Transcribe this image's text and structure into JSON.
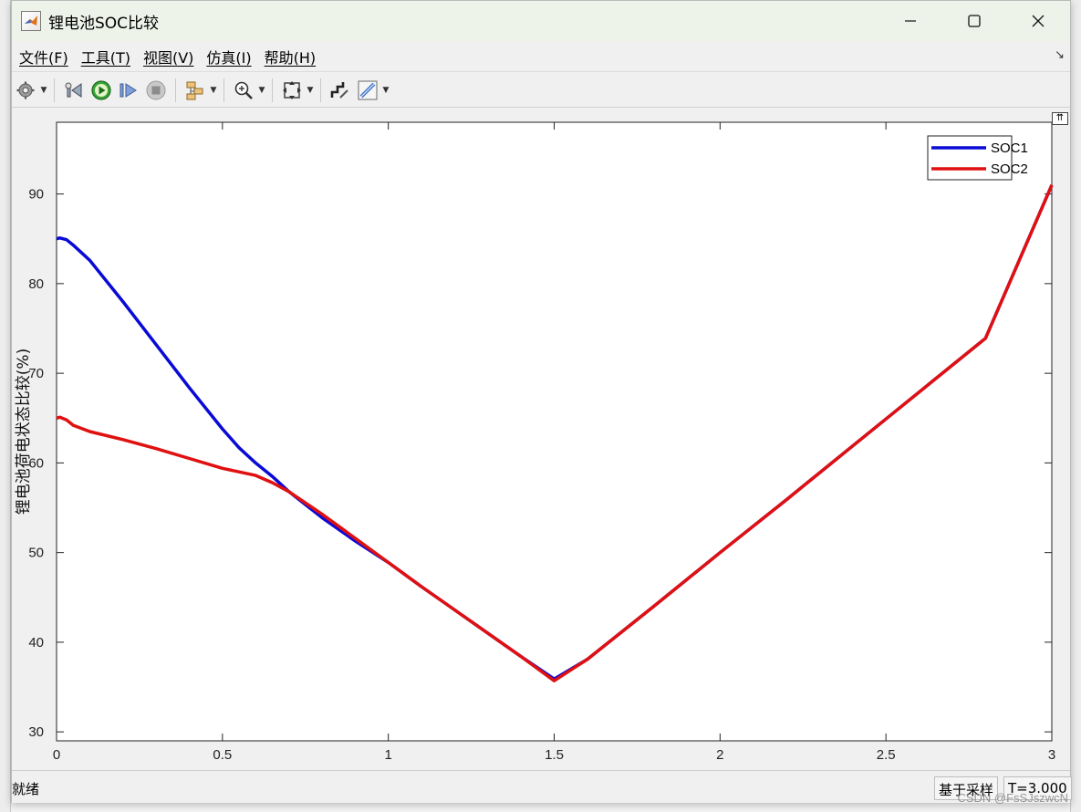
{
  "window": {
    "title": "锂电池SOC比较"
  },
  "menu": [
    {
      "label": "文件(F)"
    },
    {
      "label": "工具(T)"
    },
    {
      "label": "视图(V)"
    },
    {
      "label": "仿真(I)"
    },
    {
      "label": "帮助(H)"
    }
  ],
  "toolbar": {
    "icons": [
      "gear-icon",
      "step-back-icon",
      "run-icon",
      "step-forward-icon",
      "stop-icon",
      "signal-select-icon",
      "zoom-icon",
      "fit-view-icon",
      "style-icon",
      "measure-icon"
    ]
  },
  "status": {
    "text": "就绪",
    "solver": "基于采样",
    "time": "T=3.000"
  },
  "watermark": "CSDN @FsSJszwcN",
  "chart_data": {
    "type": "line",
    "title": "",
    "xlabel": "",
    "ylabel": "锂电池荷电状态比较(%)",
    "xlim": [
      0,
      3
    ],
    "ylim": [
      29,
      98
    ],
    "xticks": [
      0,
      0.5,
      1,
      1.5,
      2,
      2.5,
      3
    ],
    "xtick_labels": [
      "0",
      "0.5",
      "1",
      "1.5",
      "2",
      "2.5",
      "3"
    ],
    "yticks": [
      30,
      40,
      50,
      60,
      70,
      80,
      90
    ],
    "ytick_labels": [
      "30",
      "40",
      "50",
      "60",
      "70",
      "80",
      "90"
    ],
    "legend_position": "top-right",
    "grid": false,
    "series": [
      {
        "name": "SOC1",
        "color": "#0a0ad6",
        "x": [
          0,
          0.01,
          0.03,
          0.05,
          0.1,
          0.2,
          0.3,
          0.4,
          0.5,
          0.55,
          0.6,
          0.65,
          0.7,
          0.8,
          0.9,
          1.0,
          1.1,
          1.2,
          1.3,
          1.4,
          1.5,
          1.6,
          1.8,
          2.0,
          2.2,
          2.4,
          2.6,
          2.8,
          3.0
        ],
        "y": [
          85.0,
          85.1,
          84.9,
          84.3,
          82.6,
          78.0,
          73.2,
          68.4,
          63.8,
          61.7,
          60.0,
          58.5,
          56.8,
          53.9,
          51.3,
          48.9,
          46.2,
          43.6,
          41.0,
          38.4,
          35.9,
          38.1,
          44.0,
          50.0,
          55.9,
          61.9,
          67.9,
          73.9,
          91.0
        ]
      },
      {
        "name": "SOC2",
        "color": "#e01010",
        "x": [
          0,
          0.01,
          0.03,
          0.05,
          0.1,
          0.2,
          0.3,
          0.4,
          0.5,
          0.55,
          0.6,
          0.65,
          0.7,
          0.8,
          0.9,
          1.0,
          1.1,
          1.2,
          1.3,
          1.4,
          1.5,
          1.6,
          1.8,
          2.0,
          2.2,
          2.4,
          2.6,
          2.8,
          3.0
        ],
        "y": [
          65.0,
          65.1,
          64.8,
          64.2,
          63.5,
          62.6,
          61.6,
          60.5,
          59.4,
          59.0,
          58.6,
          57.8,
          56.8,
          54.3,
          51.6,
          48.9,
          46.2,
          43.6,
          41.0,
          38.4,
          35.7,
          38.1,
          44.0,
          50.0,
          55.9,
          61.9,
          67.9,
          73.9,
          91.0
        ]
      }
    ]
  }
}
